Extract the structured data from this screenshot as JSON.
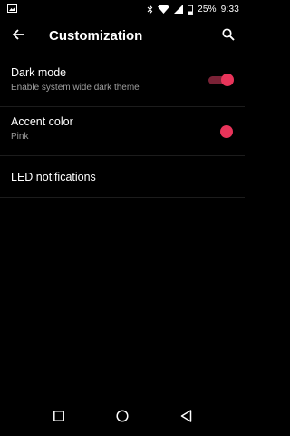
{
  "status_bar": {
    "battery_percent": "25%",
    "time": "9:33",
    "icons": [
      "image-notification-icon",
      "bluetooth-icon",
      "wifi-icon",
      "signal-icon",
      "battery-icon"
    ]
  },
  "app_bar": {
    "title": "Customization",
    "back_icon": "arrow-back-icon",
    "search_icon": "search-icon"
  },
  "settings": [
    {
      "title": "Dark mode",
      "subtitle": "Enable system wide dark theme",
      "control": "toggle",
      "enabled": true
    },
    {
      "title": "Accent color",
      "subtitle": "Pink",
      "control": "color-dot"
    },
    {
      "title": "LED notifications"
    }
  ],
  "colors": {
    "background": "#000000",
    "accent": "#e8345a",
    "accent_track": "#7a2236",
    "secondary_text": "#9e9e9e"
  },
  "nav_bar": {
    "icons": [
      "recents-square-icon",
      "home-circle-icon",
      "back-triangle-icon"
    ]
  }
}
